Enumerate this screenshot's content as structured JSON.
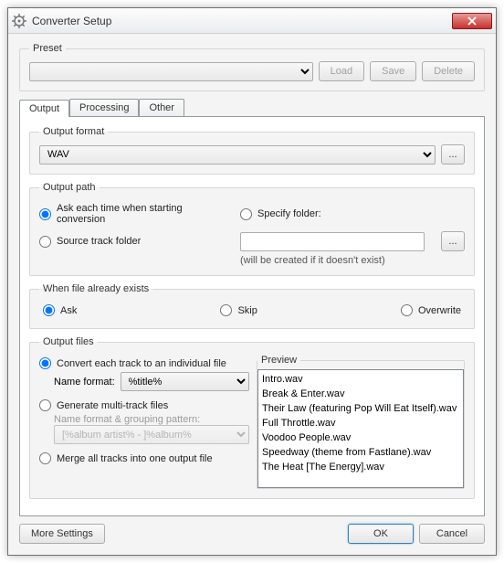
{
  "window": {
    "title": "Converter Setup"
  },
  "preset": {
    "legend": "Preset",
    "value": "",
    "load": "Load",
    "save": "Save",
    "delete": "Delete"
  },
  "tabs": {
    "output": "Output",
    "processing": "Processing",
    "other": "Other"
  },
  "output_format": {
    "legend": "Output format",
    "value": "WAV",
    "more": "..."
  },
  "output_path": {
    "legend": "Output path",
    "ask": "Ask each time when starting conversion",
    "specify": "Specify folder:",
    "source": "Source track folder",
    "folder_value": "",
    "hint": "(will be created if it doesn't exist)",
    "browse": "..."
  },
  "exists": {
    "legend": "When file already exists",
    "ask": "Ask",
    "skip": "Skip",
    "overwrite": "Overwrite"
  },
  "files": {
    "legend": "Output files",
    "convert_each": "Convert each track to an individual file",
    "name_format_label": "Name format:",
    "name_format_value": "%title%",
    "multi": "Generate multi-track files",
    "grouping_label": "Name format & grouping pattern:",
    "grouping_value": "[%album artist% - ]%album%",
    "merge": "Merge all tracks into one output file",
    "preview_legend": "Preview",
    "preview": [
      "Intro.wav",
      "Break & Enter.wav",
      "Their Law (featuring Pop Will Eat Itself).wav",
      "Full Throttle.wav",
      "Voodoo People.wav",
      "Speedway (theme from Fastlane).wav",
      "The Heat [The Energy].wav"
    ]
  },
  "footer": {
    "more": "More Settings",
    "ok": "OK",
    "cancel": "Cancel"
  }
}
